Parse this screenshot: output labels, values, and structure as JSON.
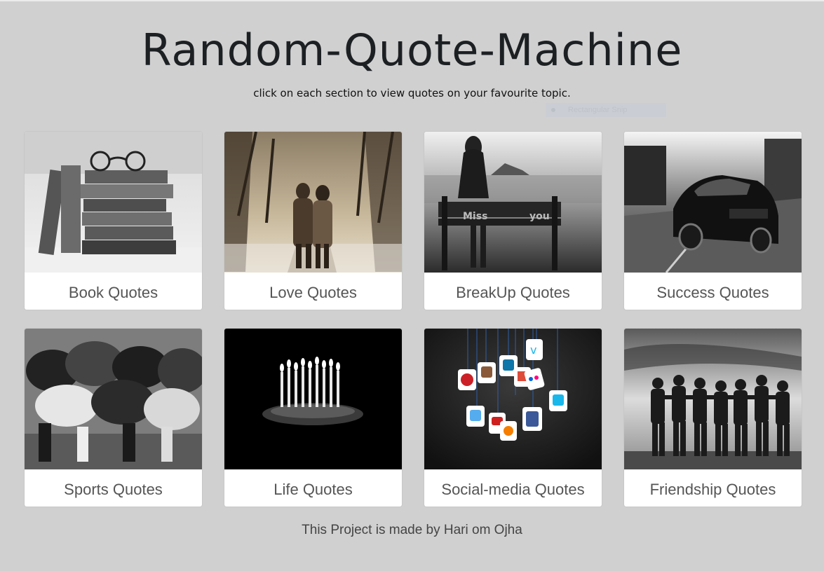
{
  "header": {
    "title": "Random-Quote-Machine",
    "subtitle": "click on each section to view quotes on your favourite topic."
  },
  "snip_overlay": {
    "label": "Rectangular Snip"
  },
  "cards": [
    {
      "label": "Book Quotes",
      "image": "stacked-books-with-glasses"
    },
    {
      "label": "Love Quotes",
      "image": "couple-walking-in-park"
    },
    {
      "label": "BreakUp Quotes",
      "image": "woman-on-bench-miss-you"
    },
    {
      "label": "Success Quotes",
      "image": "black-sports-car"
    },
    {
      "label": "Sports Quotes",
      "image": "rugby-scrum"
    },
    {
      "label": "Life Quotes",
      "image": "birthday-cake-candles"
    },
    {
      "label": "Social-media Quotes",
      "image": "hanging-social-media-icons"
    },
    {
      "label": "Friendship Quotes",
      "image": "friends-arm-in-arm"
    }
  ],
  "bench_text": {
    "left": "Miss",
    "right": "you"
  },
  "footer": {
    "text": "This Project is made by Hari om Ojha"
  }
}
